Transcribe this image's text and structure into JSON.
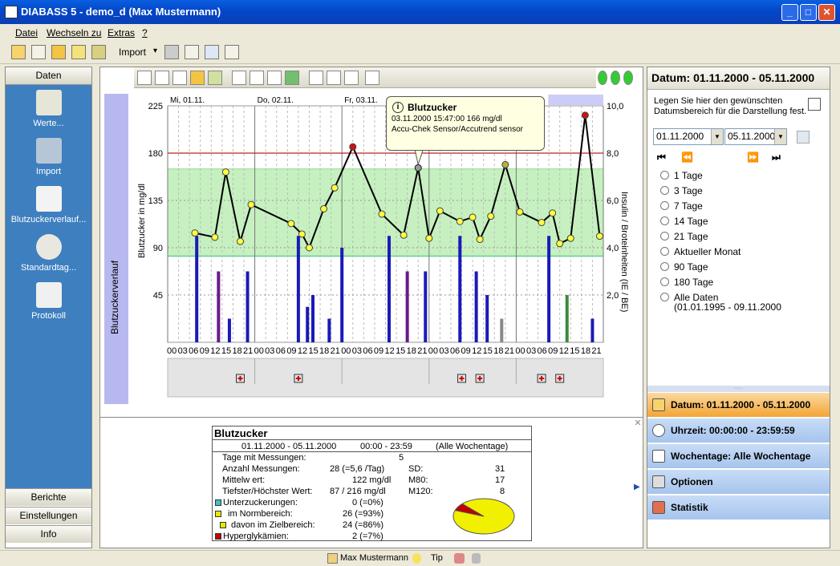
{
  "window": {
    "title": "DIABASS 5 - demo_d (Max Mustermann)",
    "minimize": "_",
    "maximize": "□",
    "close": "✕"
  },
  "menu": [
    "Datei",
    "Wechseln zu",
    "Extras",
    "?"
  ],
  "toolbar": {
    "import_label": "Import",
    "dropdown_glyph": "▾"
  },
  "left": {
    "header": "Daten",
    "items": [
      "Werte...",
      "Import",
      "Blutzuckerverlauf...",
      "Standardtag...",
      "Protokoll"
    ],
    "footer": [
      "Berichte",
      "Einstellungen",
      "Info"
    ]
  },
  "chart": {
    "side_label": "Blutzuckerverlauf",
    "tooltip": {
      "title": "Blutzucker",
      "line1": "03.11.2000 15:47:00 166 mg/dl",
      "line2": "Accu-Chek Sensor/Accutrend sensor"
    }
  },
  "chart_data": {
    "type": "line",
    "title": "",
    "days": [
      "Mi, 01.11.",
      "Do, 02.11.",
      "Fr, 03.11.",
      "",
      "11."
    ],
    "xlabel": "",
    "x_ticks": [
      "00",
      "03",
      "06",
      "09",
      "12",
      "15",
      "18",
      "21"
    ],
    "ylabel": "Blutzucker in mg/dl",
    "ylim": [
      0,
      225
    ],
    "y_ticks": [
      45,
      90,
      135,
      180,
      225
    ],
    "y2label": "Insulin / Broteinheiten (IE / BE)",
    "y2lim": [
      0,
      10
    ],
    "y2_ticks": [
      "2,0",
      "4,0",
      "6,0",
      "8,0",
      "10,0"
    ],
    "target_range": [
      82,
      165
    ],
    "hyper_line": 180,
    "series": [
      {
        "values": [
          {
            "h": 7.5,
            "v": 104
          },
          {
            "h": 13,
            "v": 100
          },
          {
            "h": 16,
            "v": 162
          },
          {
            "h": 20,
            "v": 96
          },
          {
            "h": 23,
            "v": 131
          },
          {
            "h": 34,
            "v": 113
          },
          {
            "h": 37,
            "v": 103
          },
          {
            "h": 39,
            "v": 90
          },
          {
            "h": 43,
            "v": 127
          },
          {
            "h": 46,
            "v": 147
          },
          {
            "h": 51,
            "v": 186
          },
          {
            "h": 59,
            "v": 122
          },
          {
            "h": 65,
            "v": 102
          },
          {
            "h": 69,
            "v": 166
          },
          {
            "h": 72,
            "v": 99
          },
          {
            "h": 75,
            "v": 125
          },
          {
            "h": 80.5,
            "v": 115
          },
          {
            "h": 84,
            "v": 119
          },
          {
            "h": 86,
            "v": 98
          },
          {
            "h": 89,
            "v": 120
          },
          {
            "h": 93,
            "v": 169
          },
          {
            "h": 97,
            "v": 124
          },
          {
            "h": 103,
            "v": 114
          },
          {
            "h": 106,
            "v": 123
          },
          {
            "h": 108,
            "v": 94
          },
          {
            "h": 111,
            "v": 99
          },
          {
            "h": 115,
            "v": 216
          },
          {
            "h": 119,
            "v": 101
          }
        ]
      }
    ],
    "insulin_bars": [
      {
        "h": 8,
        "v": 4.5,
        "c": "#1a1ab8"
      },
      {
        "h": 14,
        "v": 3.0,
        "c": "#6b1a8a"
      },
      {
        "h": 17,
        "v": 1.0,
        "c": "#1a1ab8"
      },
      {
        "h": 22,
        "v": 3.0,
        "c": "#1a1ab8"
      },
      {
        "h": 36,
        "v": 4.5,
        "c": "#1a1ab8"
      },
      {
        "h": 38.5,
        "v": 1.5,
        "c": "#1a1ab8"
      },
      {
        "h": 40,
        "v": 2.0,
        "c": "#1a1ab8"
      },
      {
        "h": 44.5,
        "v": 1.0,
        "c": "#1a1ab8"
      },
      {
        "h": 48,
        "v": 4.0,
        "c": "#1a1ab8"
      },
      {
        "h": 61,
        "v": 4.5,
        "c": "#1a1ab8"
      },
      {
        "h": 66,
        "v": 3.0,
        "c": "#6b1a8a"
      },
      {
        "h": 71,
        "v": 3.0,
        "c": "#1a1ab8"
      },
      {
        "h": 80.5,
        "v": 4.5,
        "c": "#1a1ab8"
      },
      {
        "h": 85,
        "v": 3.0,
        "c": "#1a1ab8"
      },
      {
        "h": 88,
        "v": 2.0,
        "c": "#1a1ab8"
      },
      {
        "h": 92,
        "v": 1.0,
        "c": "#888888"
      },
      {
        "h": 105,
        "v": 4.5,
        "c": "#1a1ab8"
      },
      {
        "h": 110,
        "v": 2.0,
        "c": "#3a8a3a"
      },
      {
        "h": 117,
        "v": 1.0,
        "c": "#1a1ab8"
      }
    ],
    "event_hours": [
      20,
      36,
      81,
      86,
      103,
      108
    ],
    "grid": true,
    "legend": "none"
  },
  "stats": {
    "title": "Blutzucker",
    "range": "01.11.2000 - 05.11.2000",
    "time": "00:00 - 23:59",
    "weekdays": "(Alle Wochentage)",
    "rows": [
      {
        "label": "Tage mit Messungen:",
        "value": "5"
      },
      {
        "label": "Anzahl Messungen:",
        "value": "28 (=5,6 /Tag)"
      },
      {
        "label": "Mittelw ert:",
        "value": "122 mg/dl"
      },
      {
        "label": "Tiefster/Höchster Wert:",
        "value": "87 / 216 mg/dl"
      }
    ],
    "side": [
      {
        "label": "SD:",
        "value": "31"
      },
      {
        "label": "M80:",
        "value": "17"
      },
      {
        "label": "M120:",
        "value": "8"
      }
    ],
    "legend": [
      {
        "label": "Unterzuckerungen:",
        "value": "0 (=0%)",
        "color": "#40c0c0"
      },
      {
        "label": "im Normbereich:",
        "value": "26 (=93%)",
        "color": "#e8e800"
      },
      {
        "label": "davon im Zielbereich:",
        "value": "24 (=86%)",
        "color": "#e8e800"
      },
      {
        "label": "Hyperglykämien:",
        "value": "2 (=7%)",
        "color": "#c00000"
      }
    ],
    "pie": [
      {
        "name": "im Normbereich",
        "value": 93,
        "color": "#f0f000"
      },
      {
        "name": "Hyperglykämien",
        "value": 7,
        "color": "#c00000"
      }
    ]
  },
  "right": {
    "title": "Datum: 01.11.2000 - 05.11.2000",
    "hint": "Legen Sie hier den gewünschten Datumsbereich für die Darstellung fest.",
    "from": "01.11.2000",
    "to": "05.11.2000",
    "nav": [
      "⏮",
      "⏪",
      "⏩",
      "⏭"
    ],
    "options": [
      "1 Tage",
      "3 Tage",
      "7 Tage",
      "14 Tage",
      "21 Tage",
      "Aktueller Monat",
      "90 Tage",
      "180 Tage",
      "Alle Daten"
    ],
    "all_range": "(01.01.1995 - 09.11.2000",
    "bands": [
      "Datum: 01.11.2000 - 05.11.2000",
      "Uhrzeit: 00:00:00 - 23:59:59",
      "Wochentage: Alle Wochentage",
      "Optionen",
      "Statistik"
    ]
  },
  "status": {
    "user": "Max Mustermann",
    "tip": "Tip"
  }
}
